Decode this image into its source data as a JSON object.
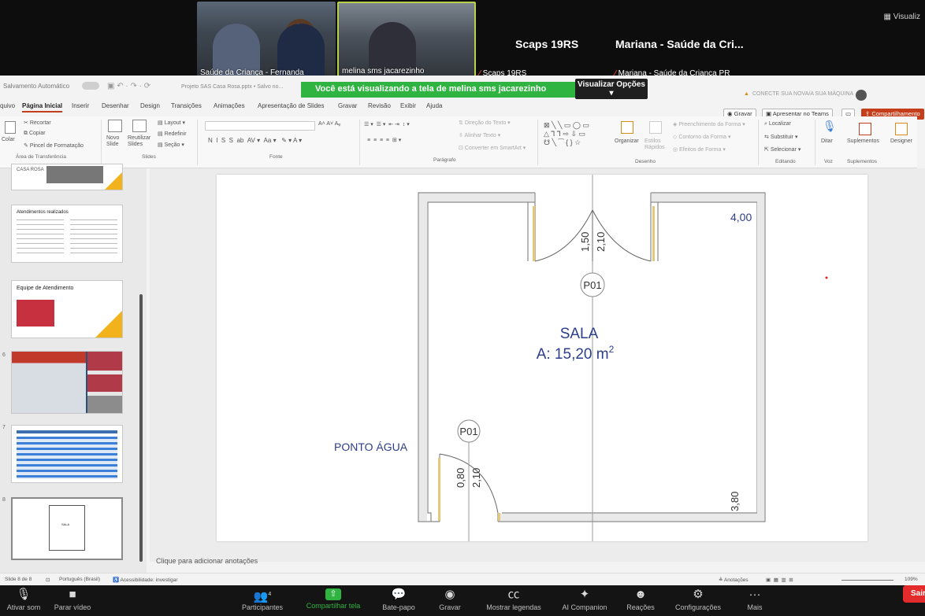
{
  "meeting": {
    "tiles": [
      {
        "name": "Saúde da Criança - Fernanda"
      },
      {
        "name": "melina sms jacarezinho"
      }
    ],
    "participants": [
      {
        "big": "Scaps 19RS",
        "small": "Scaps 19RS"
      },
      {
        "big": "Mariana - Saúde da Cri...",
        "small": "Mariana - Saúde da Criança PR"
      }
    ],
    "corner_label": "Visualiz",
    "share_banner": "Você está visualizando a tela de melina sms jacarezinho",
    "view_options": "Visualizar Opções"
  },
  "ppt": {
    "autosave": "Salvamento Automático",
    "filename": "Projeto SAS Casa Rosa.pptx • Salvo no...",
    "tabs": [
      "quivo",
      "Página Inicial",
      "Inserir",
      "Desenhar",
      "Design",
      "Transições",
      "Animações",
      "Apresentação de Slides",
      "Gravar",
      "Revisão",
      "Exibir",
      "Ajuda"
    ],
    "active_tab": "Página Inicial",
    "warning": "CONECTE SUA NOVA/A SUA MÁQUINA",
    "buttons": {
      "record": "Gravar",
      "present_teams": "Apresentar no Teams",
      "share": "Compartilhamento"
    },
    "ribbon": {
      "clipboard": [
        "Recortar",
        "Copiar",
        "Pincel de Formatação"
      ],
      "colar": "Colar",
      "clipboard_label": "Área de Transferência",
      "slides": [
        "Novo Slide",
        "Reutilizar Slides",
        "Layout",
        "Redefinir",
        "Seção"
      ],
      "slides_label": "Slides",
      "fonte_label": "Fonte",
      "paragrafo_label": "Parágrafo",
      "paragrafo_items": [
        "Direção do Texto",
        "Alinhar Texto",
        "Converter em SmartArt"
      ],
      "desenho_items": [
        "Organizar",
        "Estilos Rápidos",
        "Preenchimento da Forma",
        "Contorno da Forma",
        "Efeitos de Forma"
      ],
      "desenho_label": "Desenho",
      "editando_items": [
        "Localizar",
        "Substituir",
        "Selecionar"
      ],
      "editando_label": "Editando",
      "voz_item": "Ditar",
      "voz_label": "Voz",
      "suplementos_item": "Suplementos",
      "suplementos_label": "Suplementos",
      "designer": "Designer"
    },
    "thumbnails": [
      {
        "num": "",
        "title": "CASA ROSA"
      },
      {
        "num": "",
        "title": "Atendimentos realizados"
      },
      {
        "num": "",
        "title": "Equipe de Atendimento"
      },
      {
        "num": "6",
        "title": ""
      },
      {
        "num": "7",
        "title": ""
      },
      {
        "num": "8",
        "title": "SALA"
      }
    ],
    "slide": {
      "room_name": "SALA",
      "room_area": "A: 15,20 m",
      "area_sup": "2",
      "door_label": "P01",
      "water_point": "PONTO ÁGUA",
      "dims": {
        "top_w": "1,50",
        "top_h": "2,10",
        "bottom_w": "0,80",
        "bottom_h": "2,10",
        "width": "4,00",
        "height": "3,80"
      }
    },
    "notes_placeholder": "Clique para adicionar anotações",
    "status": {
      "slide_count": "Slide 8 de 8",
      "language": "Português (Brasil)",
      "accessibility": "Acessibilidade: investigar",
      "notes": "Anotações",
      "zoom": "109%"
    }
  },
  "zoom_toolbar": {
    "audio": "Ativar som",
    "video": "Parar vídeo",
    "participants": "Participantes",
    "participants_count": "4",
    "share": "Compartilhar tela",
    "chat": "Bate-papo",
    "record": "Gravar",
    "captions": "Mostrar legendas",
    "companion": "AI Companion",
    "reactions": "Reações",
    "settings": "Configurações",
    "more": "Mais",
    "leave": "Sair"
  }
}
